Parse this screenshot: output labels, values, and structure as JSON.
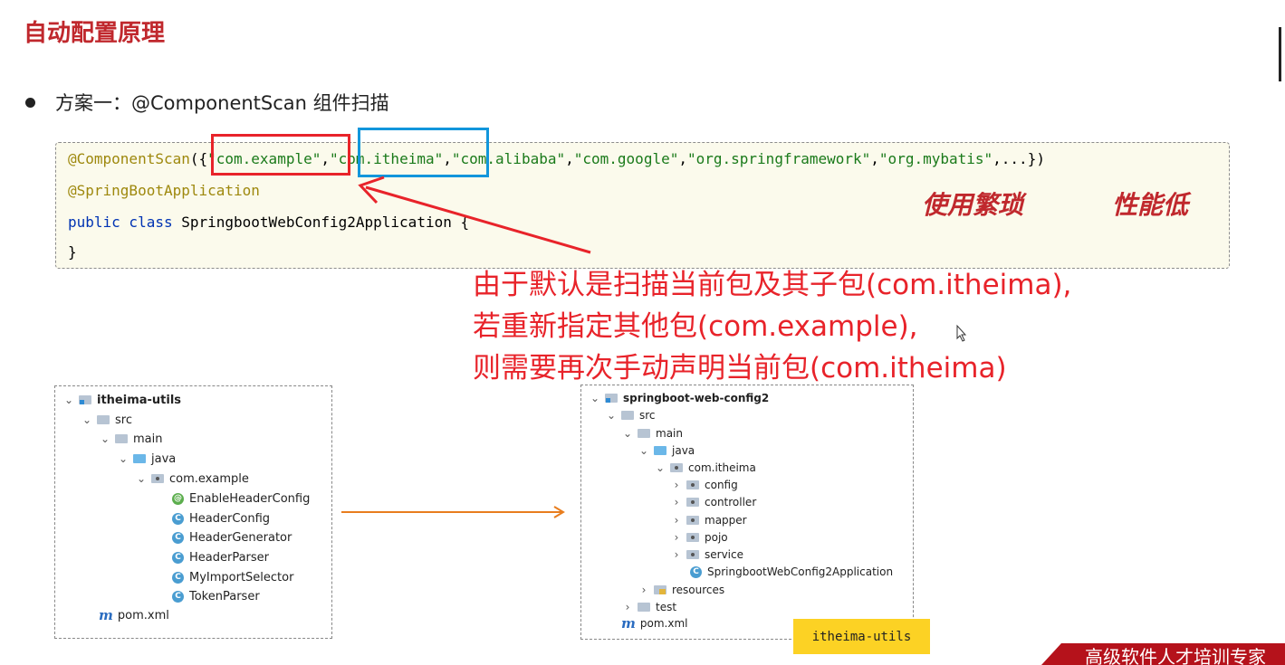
{
  "title": "自动配置原理",
  "bullet": "方案一：@ComponentScan 组件扫描",
  "code": {
    "line1_annotation": "@ComponentScan",
    "line1_open": "({",
    "strings": [
      "\"com.example\"",
      "\"com.itheima\"",
      "\"com.alibaba\"",
      "\"com.google\"",
      "\"org.springframework\"",
      "\"org.mybatis\""
    ],
    "line1_tail": ",...})",
    "line2": "@SpringBootApplication",
    "line3_kw": "public class",
    "line3_rest": " SpringbootWebConfig2Application {",
    "line4": "}"
  },
  "handnotes": [
    "使用繁琐",
    "性能低"
  ],
  "red_note": [
    "由于默认是扫描当前包及其子包(com.itheima),",
    "若重新指定其他包(com.example),",
    "则需要再次手动声明当前包(com.itheima)"
  ],
  "left_tree": {
    "root": "itheima-utils",
    "src": "src",
    "main": "main",
    "java": "java",
    "package": "com.example",
    "classes": [
      "EnableHeaderConfig",
      "HeaderConfig",
      "HeaderGenerator",
      "HeaderParser",
      "MyImportSelector",
      "TokenParser"
    ],
    "pom": "pom.xml"
  },
  "right_tree": {
    "root": "springboot-web-config2",
    "src": "src",
    "main": "main",
    "java": "java",
    "package": "com.itheima",
    "subpackages": [
      "config",
      "controller",
      "mapper",
      "pojo",
      "service"
    ],
    "app_class": "SpringbootWebConfig2Application",
    "resources": "resources",
    "test": "test",
    "pom": "pom.xml"
  },
  "tag": "itheima-utils",
  "brand": "高级软件人才培训专家",
  "colors": {
    "title": "#c0282d",
    "note": "#e8232a",
    "arrow": "#e8232a",
    "orange_arrow": "#e87d1e",
    "tag": "#fcd224"
  }
}
